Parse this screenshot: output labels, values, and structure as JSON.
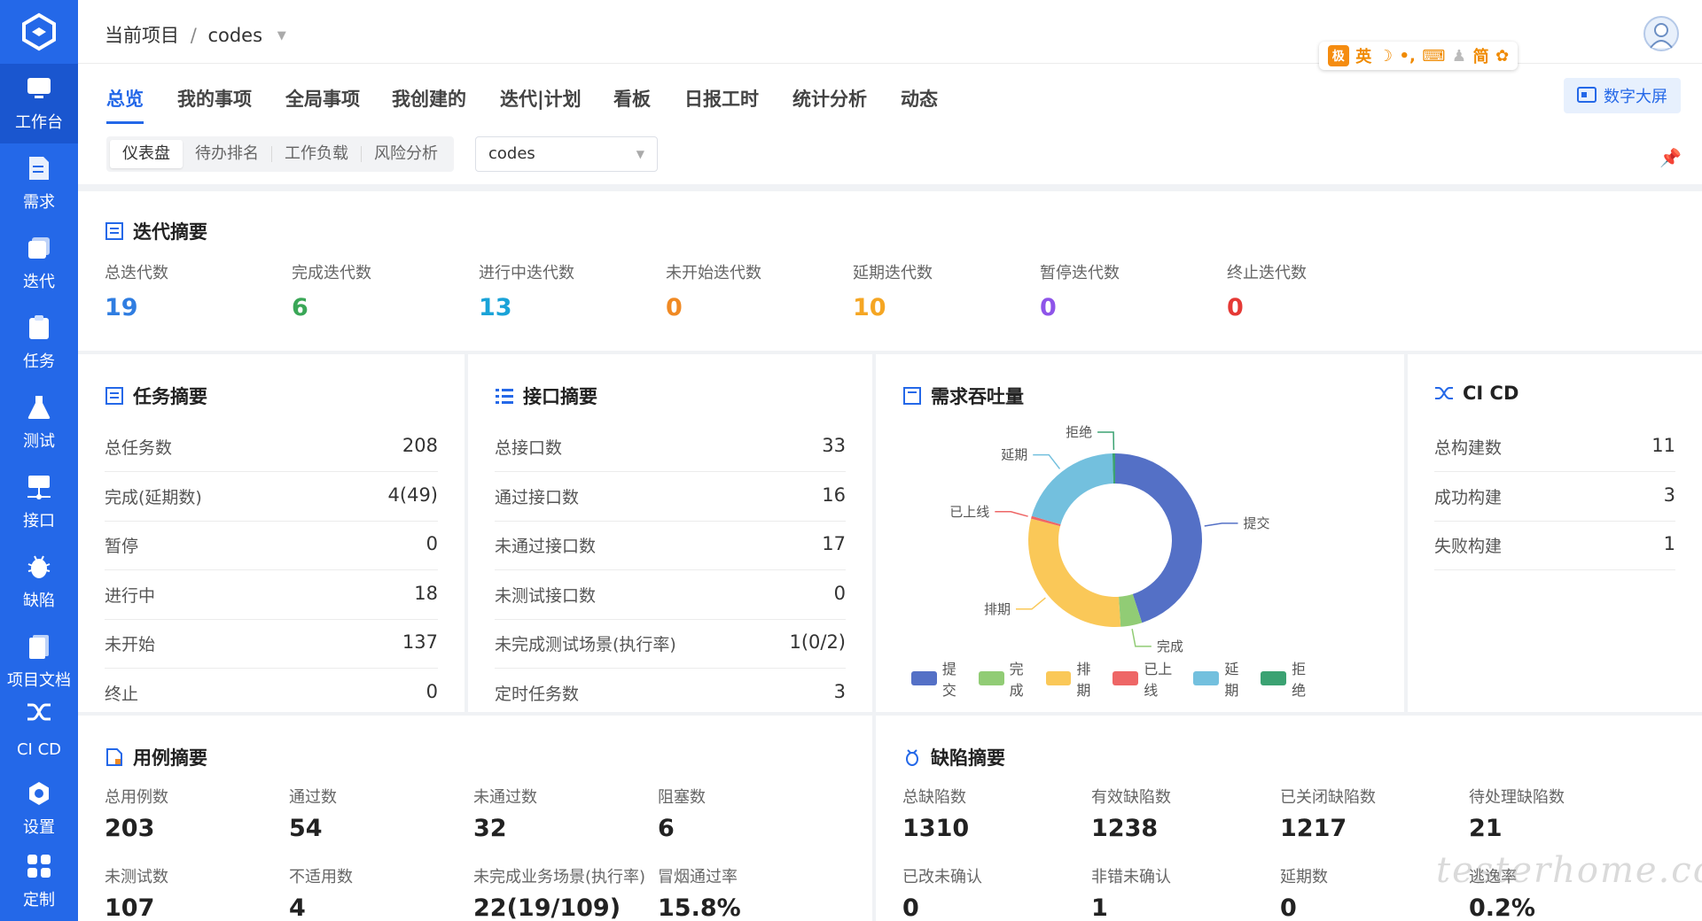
{
  "sidebar": {
    "items": [
      {
        "label": "工作台",
        "icon": "monitor-icon"
      },
      {
        "label": "需求",
        "icon": "document-icon"
      },
      {
        "label": "迭代",
        "icon": "iteration-icon"
      },
      {
        "label": "任务",
        "icon": "clipboard-icon"
      },
      {
        "label": "测试",
        "icon": "flask-icon"
      },
      {
        "label": "接口",
        "icon": "network-icon"
      },
      {
        "label": "缺陷",
        "icon": "bug-icon"
      },
      {
        "label": "项目文档",
        "icon": "file-icon"
      },
      {
        "label": "CI CD",
        "icon": "cicd-icon"
      },
      {
        "label": "设置",
        "icon": "gear-icon"
      },
      {
        "label": "定制",
        "icon": "grid-icon"
      }
    ]
  },
  "header": {
    "breadcrumb_root": "当前项目",
    "breadcrumb_sep": "/",
    "project": "codes",
    "ime": {
      "badge": "极",
      "lang": "英",
      "mode": "简"
    }
  },
  "tabs": [
    "总览",
    "我的事项",
    "全局事项",
    "我创建的",
    "迭代|计划",
    "看板",
    "日报工时",
    "统计分析",
    "动态"
  ],
  "screen_button": "数字大屏",
  "subtabs": [
    "仪表盘",
    "待办排名",
    "工作负载",
    "风险分析"
  ],
  "project_select": "codes",
  "iteration": {
    "title": "迭代摘要",
    "stats": [
      {
        "label": "总迭代数",
        "value": "19",
        "color": "#2f7de1"
      },
      {
        "label": "完成迭代数",
        "value": "6",
        "color": "#3aa757"
      },
      {
        "label": "进行中迭代数",
        "value": "13",
        "color": "#1aa3d8"
      },
      {
        "label": "未开始迭代数",
        "value": "0",
        "color": "#f08a24"
      },
      {
        "label": "延期迭代数",
        "value": "10",
        "color": "#f5a623"
      },
      {
        "label": "暂停迭代数",
        "value": "0",
        "color": "#8e54e9"
      },
      {
        "label": "终止迭代数",
        "value": "0",
        "color": "#e53935"
      }
    ]
  },
  "task": {
    "title": "任务摘要",
    "rows": [
      {
        "k": "总任务数",
        "v": "208"
      },
      {
        "k": "完成(延期数)",
        "v": "4(49)"
      },
      {
        "k": "暂停",
        "v": "0"
      },
      {
        "k": "进行中",
        "v": "18"
      },
      {
        "k": "未开始",
        "v": "137"
      },
      {
        "k": "终止",
        "v": "0"
      }
    ]
  },
  "api": {
    "title": "接口摘要",
    "rows": [
      {
        "k": "总接口数",
        "v": "33"
      },
      {
        "k": "通过接口数",
        "v": "16"
      },
      {
        "k": "未通过接口数",
        "v": "17"
      },
      {
        "k": "未测试接口数",
        "v": "0"
      },
      {
        "k": "未完成测试场景(执行率)",
        "v": "1(0/2)"
      },
      {
        "k": "定时任务数",
        "v": "3"
      }
    ]
  },
  "demand": {
    "title": "需求吞吐量",
    "chart_data": {
      "type": "pie",
      "donut": true,
      "legend_position": "bottom",
      "categories": [
        "提交",
        "完成",
        "排期",
        "已上线",
        "延期",
        "拒绝"
      ],
      "values": [
        45,
        4,
        30,
        0.5,
        20,
        0.5
      ],
      "colors": [
        "#5470c6",
        "#91cc75",
        "#fac858",
        "#ee6666",
        "#73c0de",
        "#3ba272"
      ]
    }
  },
  "cicd": {
    "title": "CI CD",
    "rows": [
      {
        "k": "总构建数",
        "v": "11"
      },
      {
        "k": "成功构建",
        "v": "3"
      },
      {
        "k": "失败构建",
        "v": "1"
      }
    ]
  },
  "cases": {
    "title": "用例摘要",
    "stats": [
      {
        "label": "总用例数",
        "value": "203"
      },
      {
        "label": "通过数",
        "value": "54"
      },
      {
        "label": "未通过数",
        "value": "32"
      },
      {
        "label": "阻塞数",
        "value": "6"
      },
      {
        "label": "未测试数",
        "value": "107"
      },
      {
        "label": "不适用数",
        "value": "4"
      },
      {
        "label": "未完成业务场景(执行率)",
        "value": "22(19/109)"
      },
      {
        "label": "冒烟通过率",
        "value": "15.8%"
      }
    ]
  },
  "defects": {
    "title": "缺陷摘要",
    "stats": [
      {
        "label": "总缺陷数",
        "value": "1310"
      },
      {
        "label": "有效缺陷数",
        "value": "1238"
      },
      {
        "label": "已关闭缺陷数",
        "value": "1217"
      },
      {
        "label": "待处理缺陷数",
        "value": "21"
      },
      {
        "label": "已改未确认",
        "value": "0"
      },
      {
        "label": "非错未确认",
        "value": "1"
      },
      {
        "label": "延期数",
        "value": "0"
      },
      {
        "label": "逃逸率",
        "value": "0.2%"
      }
    ]
  },
  "watermark": "testerhome.com",
  "colors": {
    "primary": "#2468e8"
  }
}
